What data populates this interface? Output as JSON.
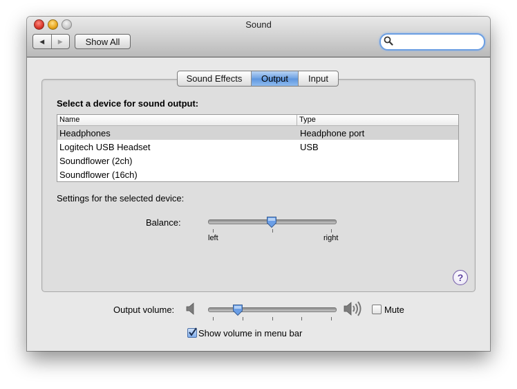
{
  "window": {
    "title": "Sound"
  },
  "toolbar": {
    "back_glyph": "◀",
    "forward_glyph": "▶",
    "show_all_label": "Show All",
    "search_value": "",
    "search_placeholder": ""
  },
  "tabs": [
    {
      "label": "Sound Effects",
      "selected": false
    },
    {
      "label": "Output",
      "selected": true
    },
    {
      "label": "Input",
      "selected": false
    }
  ],
  "output": {
    "heading": "Select a device for sound output:",
    "columns": [
      "Name",
      "Type"
    ],
    "devices": [
      {
        "name": "Headphones",
        "type": "Headphone port",
        "selected": true
      },
      {
        "name": "Logitech USB Headset",
        "type": "USB",
        "selected": false
      },
      {
        "name": "Soundflower (2ch)",
        "type": "",
        "selected": false
      },
      {
        "name": "Soundflower (16ch)",
        "type": "",
        "selected": false
      }
    ],
    "settings_label": "Settings for the selected device:",
    "balance_label": "Balance:",
    "balance_left": "left",
    "balance_right": "right",
    "balance_value": 0.5
  },
  "help_glyph": "?",
  "volume": {
    "label": "Output volume:",
    "value": 0.21,
    "mute_label": "Mute",
    "mute_checked": false,
    "show_in_menu_bar_label": "Show volume in menu bar",
    "show_in_menu_bar_checked": true
  },
  "colors": {
    "selection": "#5d95de",
    "search_focus": "#6b9ee2",
    "help": "#5b3f9f"
  },
  "icons": {
    "close": "close-button-icon",
    "minimize": "minimize-button-icon",
    "zoom": "zoom-button-icon",
    "search": "magnifier-icon",
    "speaker_low": "speaker-low-icon",
    "speaker_high": "speaker-high-icon",
    "help": "help-icon",
    "check": "checkmark-icon"
  }
}
